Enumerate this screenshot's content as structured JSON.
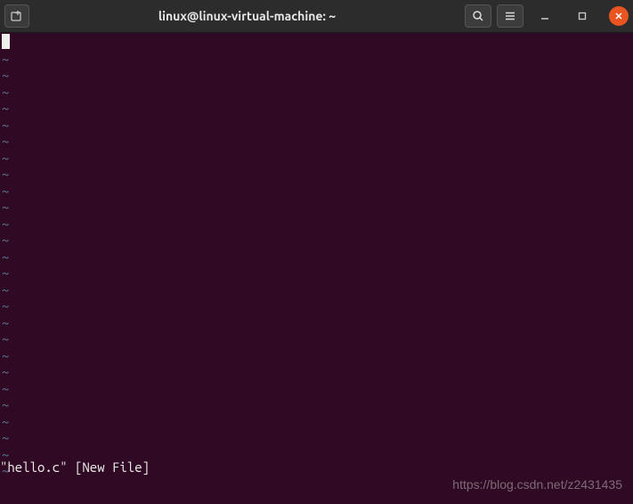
{
  "titlebar": {
    "title": "linux@linux-virtual-machine: ~"
  },
  "editor": {
    "tilde_char": "~",
    "tilde_count": 26
  },
  "status_line": "\"hello.c\" [New File]",
  "watermark": "https://blog.csdn.net/z2431435"
}
